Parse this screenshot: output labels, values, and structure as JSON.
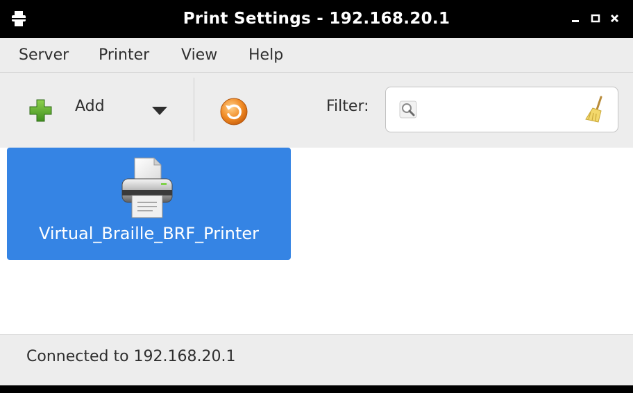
{
  "window": {
    "title": "Print Settings - 192.168.20.1"
  },
  "menu": {
    "items": [
      {
        "label": "Server"
      },
      {
        "label": "Printer"
      },
      {
        "label": "View"
      },
      {
        "label": "Help"
      }
    ]
  },
  "toolbar": {
    "add_label": "Add",
    "add_icon": "plus-icon",
    "add_dropdown_icon": "chevron-down-icon",
    "refresh_icon": "refresh-icon",
    "filter_label": "Filter:",
    "filter_value": "",
    "filter_search_icon": "search-icon",
    "filter_clear_icon": "clear-broom-icon"
  },
  "printers": [
    {
      "name": "Virtual_Braille_BRF_Printer",
      "icon": "printer-icon",
      "selected": true
    }
  ],
  "status": {
    "text": "Connected to 192.168.20.1"
  },
  "colors": {
    "selection": "#3584e4",
    "toolbar_bg": "#ededed",
    "titlebar_bg": "#000000"
  }
}
